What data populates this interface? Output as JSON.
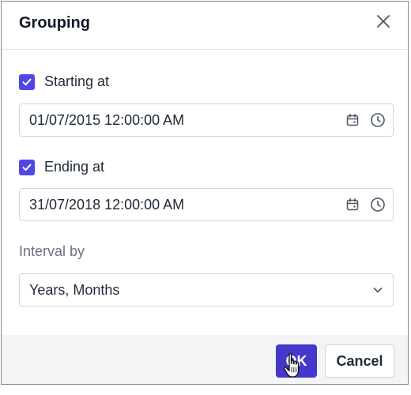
{
  "dialog": {
    "title": "Grouping",
    "close_icon": "close-icon"
  },
  "starting": {
    "checked": true,
    "label": "Starting at",
    "value": "01/07/2015 12:00:00 AM"
  },
  "ending": {
    "checked": true,
    "label": "Ending at",
    "value": "31/07/2018 12:00:00 AM"
  },
  "interval": {
    "label": "Interval by",
    "value": "Years, Months"
  },
  "footer": {
    "ok_label": "OK",
    "cancel_label": "Cancel"
  },
  "icons": {
    "calendar": "calendar-icon",
    "clock": "clock-icon",
    "dropdown": "chevron-down-icon",
    "cursor": "hand-pointer-icon"
  },
  "colors": {
    "accent": "#4f46e5",
    "ok_button": "#4338ca",
    "footer_bg": "#f3f4f6"
  }
}
